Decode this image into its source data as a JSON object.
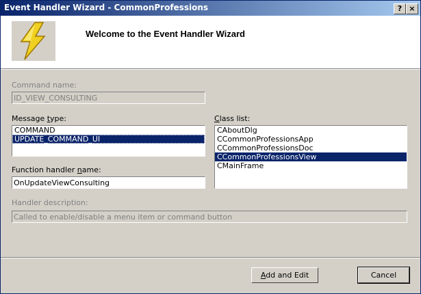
{
  "window": {
    "title": "Event Handler Wizard - CommonProfessions",
    "help_glyph": "?",
    "close_glyph": "×"
  },
  "header": {
    "welcome": "Welcome to the Event Handler Wizard",
    "logo_icon": "lightning-bolt-icon"
  },
  "command": {
    "label": "Command name:",
    "value": "ID_VIEW_CONSULTING"
  },
  "message_type": {
    "label": "Message type:",
    "items": [
      {
        "text": "COMMAND",
        "selected": false
      },
      {
        "text": "UPDATE_COMMAND_UI",
        "selected": true
      }
    ]
  },
  "class_list": {
    "label": "Class list:",
    "items": [
      {
        "text": "CAboutDlg",
        "selected": false
      },
      {
        "text": "CCommonProfessionsApp",
        "selected": false
      },
      {
        "text": "CCommonProfessionsDoc",
        "selected": false
      },
      {
        "text": "CCommonProfessionsView",
        "selected": true
      },
      {
        "text": "CMainFrame",
        "selected": false
      }
    ]
  },
  "function_handler": {
    "label": "Function handler name:",
    "value": "OnUpdateViewConsulting"
  },
  "handler_description": {
    "label": "Handler description:",
    "value": "Called to enable/disable a menu item or command button"
  },
  "buttons": {
    "add_edit": "Add and Edit",
    "cancel": "Cancel"
  },
  "colors": {
    "title_start": "#0a246a",
    "title_end": "#a6caf0",
    "selection": "#0a246a",
    "face": "#d4d0c8"
  }
}
